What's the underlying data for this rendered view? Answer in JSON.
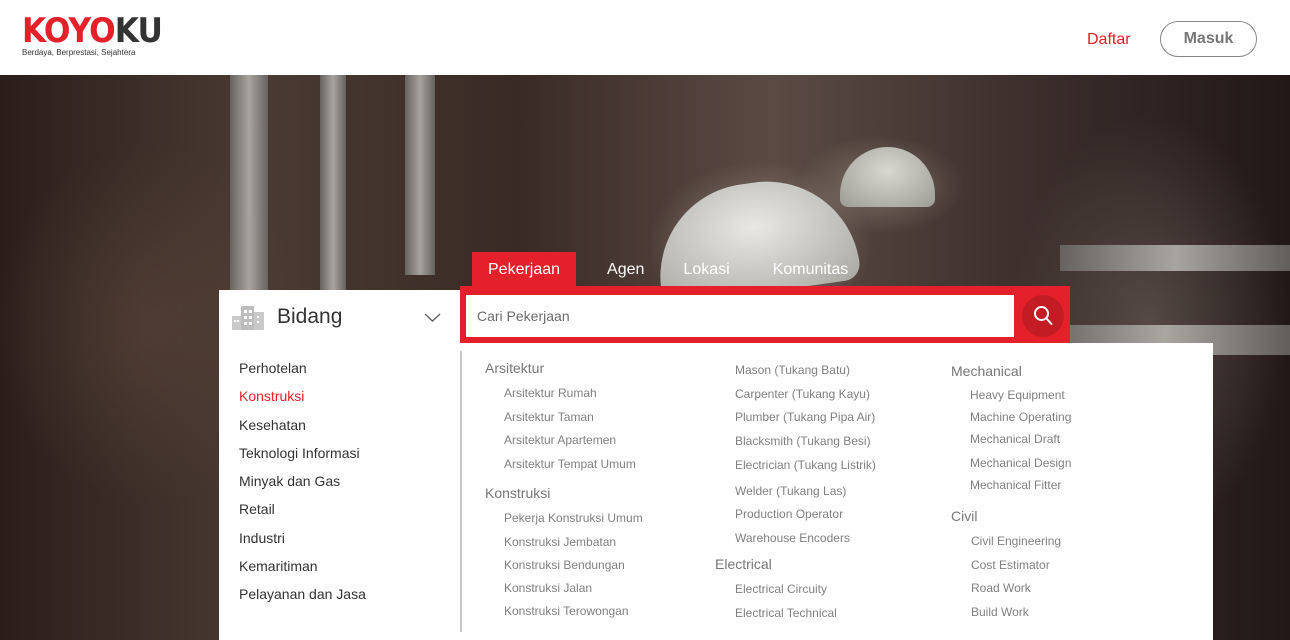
{
  "header": {
    "logo": {
      "part1": "KOYO",
      "part2": "KU",
      "tagline": "Berdaya, Berprestasi, Sejahtera"
    },
    "daftar": "Daftar",
    "masuk": "Masuk"
  },
  "tabs": [
    "Pekerjaan",
    "Agen",
    "Lokasi",
    "Komunitas"
  ],
  "search": {
    "placeholder": "Cari Pekerjaan"
  },
  "bidang": {
    "label": "Bidang",
    "categories": [
      "Perhotelan",
      "Konstruksi",
      "Kesehatan",
      "Teknologi Informasi",
      "Minyak dan Gas",
      "Retail",
      "Industri",
      "Kemaritiman",
      "Pelayanan dan Jasa"
    ],
    "active": "Konstruksi"
  },
  "groups": {
    "arsitektur": {
      "title": "Arsitektur",
      "items": [
        "Arsitektur Rumah",
        "Arsitektur Taman",
        "Arsitektur Apartemen",
        "Arsitektur Tempat Umum"
      ]
    },
    "konstruksi": {
      "title": "Konstruksi",
      "items": [
        "Pekerja Konstruksi Umum",
        "Konstruksi Jembatan",
        "Konstruksi Bendungan",
        "Konstruksi Jalan",
        "Konstruksi Terowongan"
      ]
    },
    "trades": {
      "items": [
        "Mason (Tukang Batu)",
        "Carpenter (Tukang Kayu)",
        "Plumber (Tukang Pipa Air)",
        "Blacksmith (Tukang Besi)",
        "Electrician (Tukang Listrik)",
        "Welder (Tukang Las)",
        "Production Operator",
        "Warehouse Encoders"
      ]
    },
    "electrical": {
      "title": "Electrical",
      "items": [
        "Electrical Circuity",
        "Electrical Technical"
      ]
    },
    "mechanical": {
      "title": "Mechanical",
      "items": [
        "Heavy Equipment",
        "Machine Operating",
        "Mechanical Draft",
        "Mechanical Design",
        "Mechanical Fitter"
      ]
    },
    "civil": {
      "title": "Civil",
      "items": [
        "Civil Engineering",
        "Cost Estimator",
        "Road Work",
        "Build Work"
      ]
    }
  },
  "colors": {
    "accent": "#e4202a",
    "dark": "#333333"
  },
  "icons": [
    "building-icon",
    "chevron-down-icon",
    "search-icon"
  ]
}
